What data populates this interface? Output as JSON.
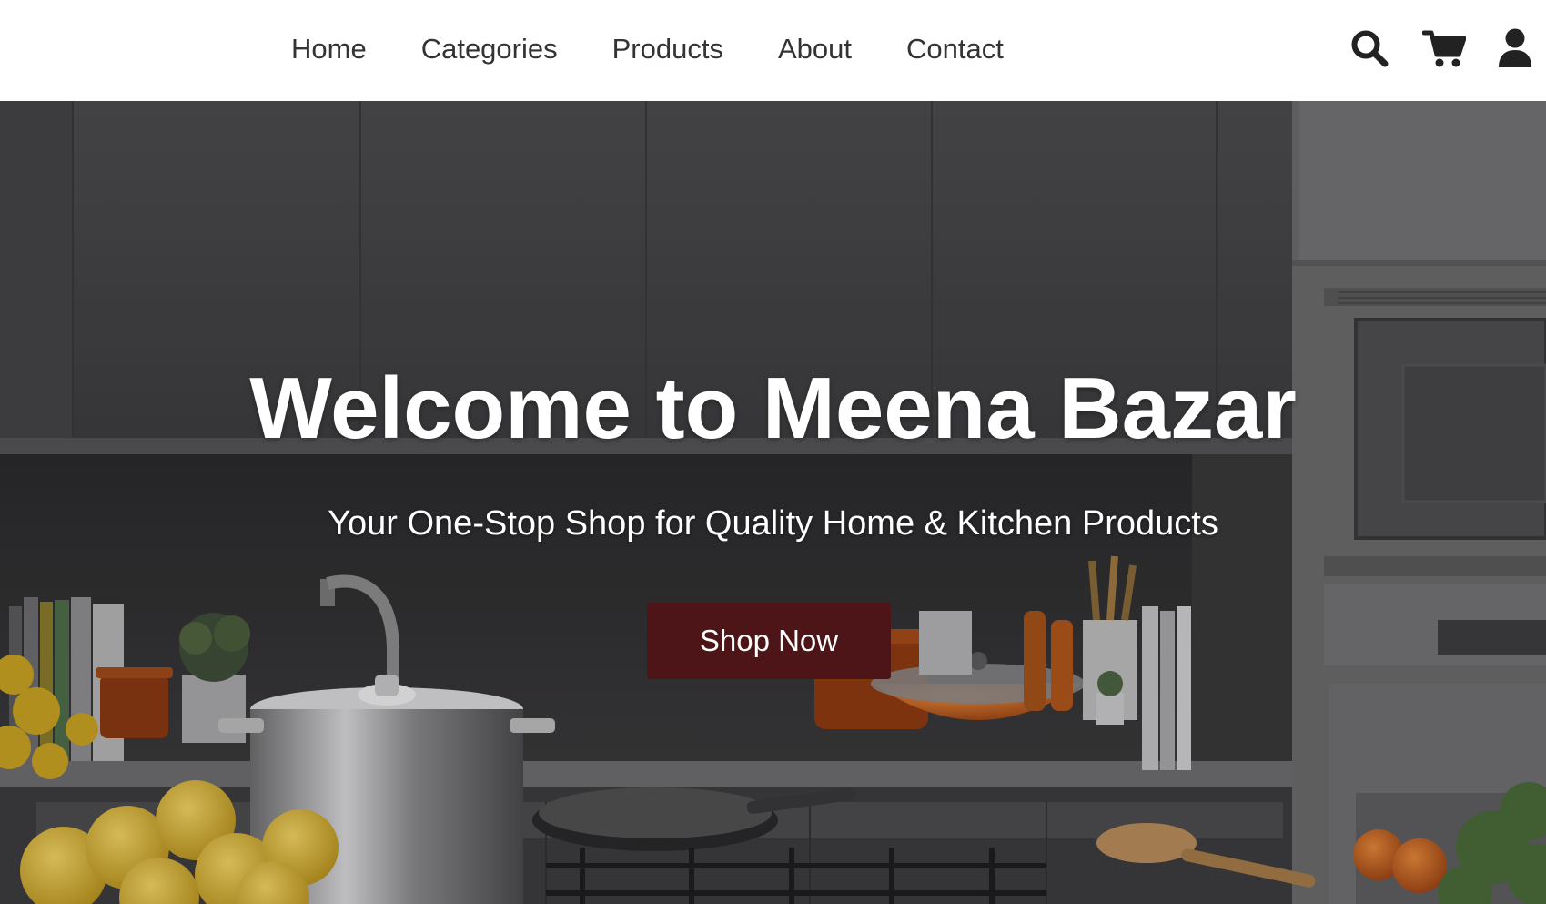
{
  "nav": {
    "links": [
      {
        "label": "Home"
      },
      {
        "label": "Categories"
      },
      {
        "label": "Products"
      },
      {
        "label": "About"
      },
      {
        "label": "Contact"
      }
    ],
    "icons": [
      "search-icon",
      "cart-icon",
      "user-icon"
    ]
  },
  "hero": {
    "title": "Welcome to Meena Bazar",
    "subtitle": "Your One-Stop Shop for Quality Home & Kitchen Products",
    "cta_label": "Shop Now",
    "background_image": "kitchen-scene"
  },
  "colors": {
    "nav_bg": "#ffffff",
    "nav_text": "#333333",
    "hero_text": "#ffffff",
    "cta_bg": "#4e1518"
  }
}
